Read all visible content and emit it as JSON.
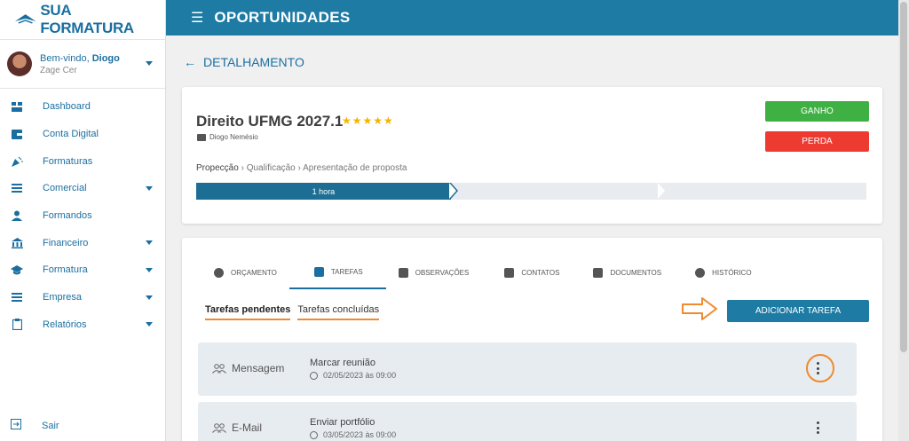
{
  "brand": {
    "logo_text": "SUA FORMATURA",
    "accent": "#1d7ba4",
    "annotation_color": "#f08a2e"
  },
  "user": {
    "welcome": "Bem-vindo, ",
    "name": "Diogo",
    "subtitle": "Zage Cer"
  },
  "sidebar": {
    "items": [
      {
        "label": "Dashboard",
        "icon": "dashboard-icon"
      },
      {
        "label": "Conta Digital",
        "icon": "wallet-icon"
      },
      {
        "label": "Formaturas",
        "icon": "celebration-icon"
      },
      {
        "label": "Comercial",
        "icon": "list-icon"
      },
      {
        "label": "Formandos",
        "icon": "person-icon"
      },
      {
        "label": "Financeiro",
        "icon": "bank-icon"
      },
      {
        "label": "Formatura",
        "icon": "graduation-cap-icon"
      },
      {
        "label": "Empresa",
        "icon": "list-icon"
      },
      {
        "label": "Relatórios",
        "icon": "clipboard-icon"
      }
    ],
    "logout": "Sair"
  },
  "topbar": {
    "title": "OPORTUNIDADES"
  },
  "page": {
    "back_label": "DETALHAMENTO"
  },
  "deal": {
    "title": "Direito UFMG 2027.1",
    "rating": 5,
    "stars": "★★★★★",
    "owner": "Diogo Nemésio",
    "won_label": "GANHO",
    "lost_label": "PERDA",
    "breadcrumb": {
      "current": "Propecção",
      "steps": [
        "Qualificação",
        "Apresentação de proposta"
      ],
      "separator": "›"
    },
    "stage_time": "1 hora",
    "stage_progress": 0.38
  },
  "tabs": [
    {
      "label": "ORÇAMENTO",
      "icon": "dollar-icon"
    },
    {
      "label": "TAREFAS",
      "icon": "checkbox-icon",
      "active": true
    },
    {
      "label": "OBSERVAÇÕES",
      "icon": "comment-icon"
    },
    {
      "label": "CONTATOS",
      "icon": "contact-icon"
    },
    {
      "label": "DOCUMENTOS",
      "icon": "document-icon"
    },
    {
      "label": "HISTÓRICO",
      "icon": "history-icon"
    }
  ],
  "subtabs": {
    "pending": "Tarefas pendentes",
    "done": "Tarefas concluídas"
  },
  "add_task_label": "ADICIONAR TAREFA",
  "tasks": [
    {
      "type": "Mensagem",
      "title": "Marcar reunião",
      "date": "02/05/2023 às 09:00"
    },
    {
      "type": "E-Mail",
      "title": "Enviar portfólio",
      "date": "03/05/2023 às 09:00"
    }
  ]
}
